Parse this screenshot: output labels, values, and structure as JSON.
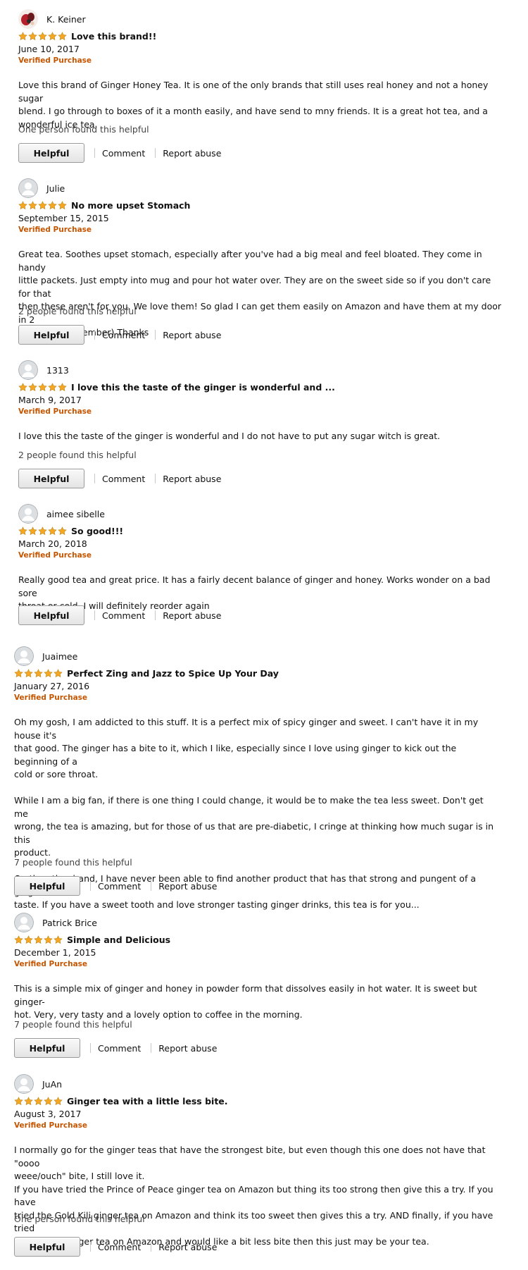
{
  "colors": {
    "star": "#f5a623",
    "star_outline": "#c1891a",
    "verified": "#c45500"
  },
  "star_icon": "star-icon",
  "reviews": [
    {
      "author": "K. Keiner",
      "avatar": "photo",
      "rating": 5,
      "title": "Love this brand!!",
      "date": "June 10, 2017",
      "verified": "Verified Purchase",
      "paragraphs": [
        "Love this brand of Ginger Honey Tea. It is one of the only brands that still uses real honey and not a honey sugar\nblend. I go through to boxes of it a month easily, and have send to mny friends. It is a great hot tea, and a\nwonderful ice tea."
      ],
      "helpful_count": "One person found this helpful",
      "helpful_label": "Helpful",
      "comment_label": "Comment",
      "report_label": "Report abuse"
    },
    {
      "author": "Julie",
      "avatar": "default",
      "rating": 5,
      "title": "No more upset Stomach",
      "date": "September 15, 2015",
      "verified": "Verified Purchase",
      "paragraphs": [
        "Great tea. Soothes upset stomach, especially after you've had a big meal and feel bloated. They come in handy\nlittle packets. Just empty into mug and pour hot water over. They are on the sweet side so if you don't care for that\nthen these aren't for you. We love them! So glad I can get them easily on Amazon and have them at my door in 2\ndays (prime member) Thanks"
      ],
      "helpful_count": "2 people found this helpful",
      "helpful_label": "Helpful",
      "comment_label": "Comment",
      "report_label": "Report abuse"
    },
    {
      "author": "1313",
      "avatar": "default",
      "rating": 5,
      "title": "I love this the taste of the ginger is wonderful and ...",
      "date": "March 9, 2017",
      "verified": "Verified Purchase",
      "paragraphs": [
        "I love this the taste of the ginger is wonderful and I do not have to put any sugar witch is great."
      ],
      "helpful_count": "2 people found this helpful",
      "helpful_label": "Helpful",
      "comment_label": "Comment",
      "report_label": "Report abuse"
    },
    {
      "author": "aimee sibelle",
      "avatar": "default",
      "rating": 5,
      "title": "So good!!!",
      "date": "March 20, 2018",
      "verified": "Verified Purchase",
      "paragraphs": [
        "Really good tea and great price. It has a fairly decent balance of ginger and honey. Works wonder on a bad sore\nthroat or cold. I will definitely reorder again"
      ],
      "helpful_count": "",
      "helpful_label": "Helpful",
      "comment_label": "Comment",
      "report_label": "Report abuse"
    },
    {
      "author": "Juaimee",
      "avatar": "default",
      "rating": 5,
      "title": "Perfect Zing and Jazz to Spice Up Your Day",
      "date": "January 27, 2016",
      "verified": "Verified Purchase",
      "paragraphs": [
        "Oh my gosh, I am addicted to this stuff. It is a perfect mix of spicy ginger and sweet. I can't have it in my house it's\nthat good. The ginger has a bite to it, which I like, especially since I love using ginger to kick out the beginning of a\ncold or sore throat.",
        "While I am a big fan, if there is one thing I could change, it would be to make the tea less sweet. Don't get me\nwrong, the tea is amazing, but for those of us that are pre-diabetic, I cringe at thinking how much sugar is in this\nproduct.",
        "On the other hand, I have never been able to find another product that has that strong and pungent of a ginger\ntaste. If you have a sweet tooth and love stronger tasting ginger drinks, this tea is for you..."
      ],
      "helpful_count": "7 people found this helpful",
      "helpful_label": "Helpful",
      "comment_label": "Comment",
      "report_label": "Report abuse"
    },
    {
      "author": "Patrick Brice",
      "avatar": "default",
      "rating": 5,
      "title": "Simple and Delicious",
      "date": "December 1, 2015",
      "verified": "Verified Purchase",
      "paragraphs": [
        "This is a simple mix of ginger and honey in powder form that dissolves easily in hot water. It is sweet but ginger-\nhot. Very, very tasty and a lovely option to coffee in the morning."
      ],
      "helpful_count": "7 people found this helpful",
      "helpful_label": "Helpful",
      "comment_label": "Comment",
      "report_label": "Report abuse"
    },
    {
      "author": "JuAn",
      "avatar": "default",
      "rating": 5,
      "title": "Ginger tea with a little less bite.",
      "date": "August 3, 2017",
      "verified": "Verified Purchase",
      "paragraphs": [
        "I normally go for the ginger teas that have the strongest bite, but even though this one does not have that \"oooo\nweee/ouch\" bite, I still love it.\nIf you have tried the Prince of Peace ginger tea on Amazon but thing its too strong then give this a try. If you have\ntried the Gold Kili ginger tea on Amazon and think its too sweet then gives this a try. AND finally, if you have tried\nthe Dali All ginger tea on Amazon and would like a bit less bite then this just may be your tea."
      ],
      "helpful_count": "One person found this helpful",
      "helpful_label": "Helpful",
      "comment_label": "Comment",
      "report_label": "Report abuse"
    }
  ]
}
